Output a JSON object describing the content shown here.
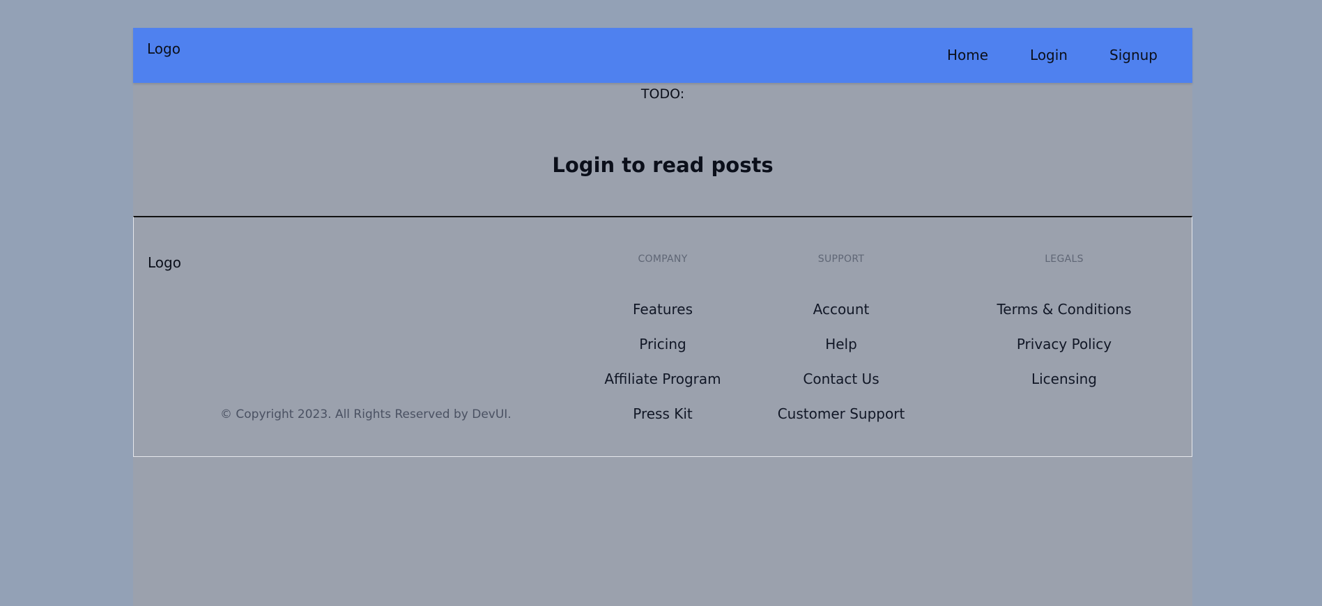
{
  "nav": {
    "logo": "Logo",
    "links": [
      "Home",
      "Login",
      "Signup"
    ]
  },
  "main": {
    "todo": "TODO:",
    "heading": "Login to read posts"
  },
  "footer": {
    "logo": "Logo",
    "copyright": "© Copyright 2023. All Rights Reserved by DevUI.",
    "columns": [
      {
        "heading": "COMPANY",
        "links": [
          "Features",
          "Pricing",
          "Affiliate Program",
          "Press Kit"
        ]
      },
      {
        "heading": "SUPPORT",
        "links": [
          "Account",
          "Help",
          "Contact Us",
          "Customer Support"
        ]
      },
      {
        "heading": "LEGALS",
        "links": [
          "Terms & Conditions",
          "Privacy Policy",
          "Licensing"
        ]
      }
    ]
  },
  "colors": {
    "background": "#93a1b6",
    "shell": "#9ba1ad",
    "navbar": "#4f81ef",
    "text": "#0b0f1a",
    "muted": "#5f6675"
  }
}
